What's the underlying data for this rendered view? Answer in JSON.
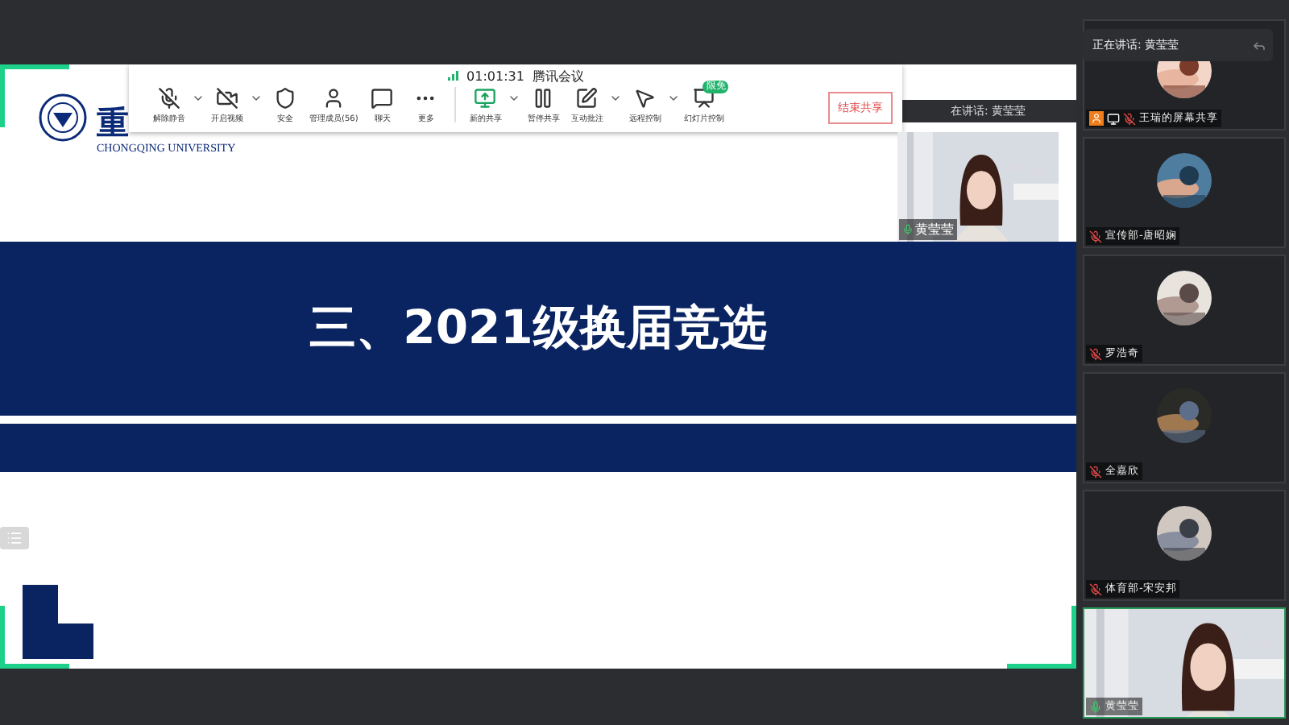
{
  "meeting": {
    "time": "01:01:31",
    "title": "腾讯会议"
  },
  "toolbar": {
    "items": [
      {
        "kind": "mic",
        "label": "解除静音",
        "menu": true
      },
      {
        "kind": "video",
        "label": "开启视频",
        "menu": true
      },
      {
        "kind": "shield",
        "label": "安全",
        "menu": false
      },
      {
        "kind": "members",
        "label": "管理成员(56)",
        "menu": false
      },
      {
        "kind": "chat",
        "label": "聊天",
        "menu": false
      },
      {
        "kind": "more",
        "label": "更多",
        "menu": false
      },
      {
        "kind": "share",
        "label": "新的共享",
        "menu": true
      },
      {
        "kind": "pause",
        "label": "暂停共享",
        "menu": false
      },
      {
        "kind": "annotate",
        "label": "互动批注",
        "menu": true
      },
      {
        "kind": "remote",
        "label": "远程控制",
        "menu": true
      },
      {
        "kind": "slides",
        "label": "幻灯片控制",
        "menu": false,
        "badge": "限免"
      }
    ],
    "end_button": "结束共享"
  },
  "slide": {
    "logo_char": "重",
    "university": "CHONGQING UNIVERSITY",
    "title": "三、2021级换届竞选"
  },
  "presenter_video": {
    "speaking": "在讲话: 黄莹莹",
    "name": "黄莹莹"
  },
  "speaking_tooltip": "正在讲话: 黄莹莹",
  "participants": [
    {
      "name": "王瑞的屏幕共享",
      "kind": "avatar",
      "host": true,
      "muted": true
    },
    {
      "name": "宣传部-唐昭娴",
      "kind": "avatar",
      "host": false,
      "muted": true
    },
    {
      "name": "罗浩奇",
      "kind": "avatar",
      "host": false,
      "muted": true
    },
    {
      "name": "全嘉欣",
      "kind": "avatar",
      "host": false,
      "muted": true
    },
    {
      "name": "体育部-宋安邦",
      "kind": "avatar",
      "host": false,
      "muted": true
    },
    {
      "name": "黄莹莹",
      "kind": "video",
      "host": false,
      "muted": false
    }
  ]
}
